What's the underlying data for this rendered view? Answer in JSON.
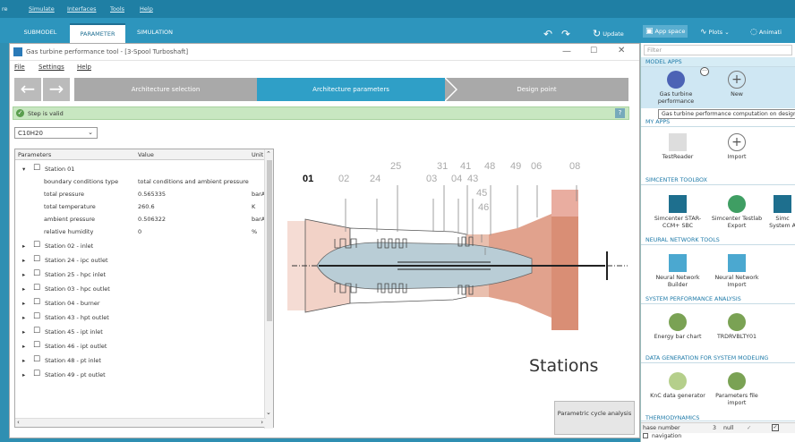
{
  "menu": {
    "items": [
      "re",
      "Simulate",
      "Interfaces",
      "Tools",
      "Help"
    ]
  },
  "ribbon": {
    "tabs": [
      "SUBMODEL",
      "PARAMETER",
      "SIMULATION"
    ],
    "update_label": "Update",
    "app_space_label": "App space",
    "plots_label": "Plots",
    "animation_label": "Animati"
  },
  "window": {
    "title": "Gas turbine performance tool - [3-Spool Turboshaft]",
    "menu": [
      "File",
      "Settings",
      "Help"
    ],
    "steps": [
      "Architecture selection",
      "Architecture parameters",
      "Design point"
    ],
    "status": "Step is valid",
    "help_mark": "?",
    "fuel": "C10H20",
    "table": {
      "headers": [
        "Parameters",
        "Value",
        "Unit"
      ],
      "station01": {
        "name": "Station 01",
        "rows": [
          {
            "p": "boundary conditions type",
            "v": "total conditions and ambient pressure",
            "u": ""
          },
          {
            "p": "total pressure",
            "v": "0.565335",
            "u": "barA"
          },
          {
            "p": "total temperature",
            "v": "260.6",
            "u": "K"
          },
          {
            "p": "ambient pressure",
            "v": "0.506322",
            "u": "barA"
          },
          {
            "p": "relative humidity",
            "v": "0",
            "u": "%"
          }
        ]
      },
      "collapsed": [
        "Station 02 - inlet",
        "Station 24 - ipc outlet",
        "Station 25 - hpc inlet",
        "Station 03 - hpc outlet",
        "Station 04 - burner",
        "Station 43 - hpt outlet",
        "Station 45 - ipt inlet",
        "Station 46 - ipt outlet",
        "Station 48 - pt inlet",
        "Station 49 - pt outlet"
      ]
    },
    "diagram": {
      "labels": [
        "01",
        "02",
        "24",
        "25",
        "03",
        "31",
        "04",
        "41",
        "43",
        "48",
        "45",
        "46",
        "49",
        "06",
        "08"
      ],
      "caption": "Stations"
    },
    "parametric_button": "Parametric cycle analysis"
  },
  "right_panel": {
    "filter_placeholder": "Filter",
    "sections": {
      "model_apps": "MODEL APPS",
      "my_apps": "MY APPS",
      "simcenter": "SIMCENTER TOOLBOX",
      "neural": "NEURAL NETWORK TOOLS",
      "sysperf": "SYSTEM PERFORMANCE ANALYSIS",
      "datagen": "DATA GENERATION FOR SYSTEM MODELING",
      "thermo": "THERMODYNAMICS"
    },
    "apps": {
      "gas_turbine": "Gas turbine performance",
      "new": "New",
      "testreader": "TestReader",
      "import": "Import",
      "starccm": "Simcenter STAR-CCM+ SBC",
      "testlab": "Simcenter Testlab Export",
      "sysa": "Simc System A",
      "nn_builder": "Neural Network Builder",
      "nn_import": "Neural Network Import",
      "energy": "Energy bar chart",
      "trdr": "TRDRVBLTY01",
      "knc": "KnC data generator",
      "params": "Parameters file import"
    },
    "tooltip": "Gas turbine performance computation on design",
    "bottom": {
      "phase_label": "hase number",
      "phase_value": "3",
      "phase_null": "null",
      "navigation": "navigation"
    }
  },
  "colors": {
    "accent": "#2d95bd",
    "step_active": "#2f9fc7",
    "step_inactive": "#a9a9a9",
    "valid_bg": "#c8e7c1"
  }
}
